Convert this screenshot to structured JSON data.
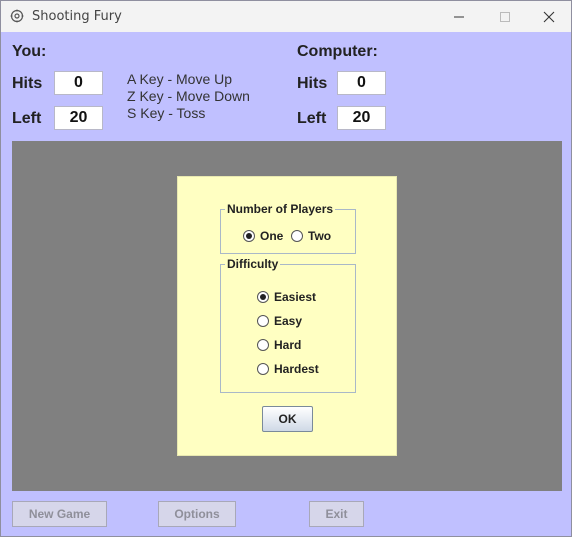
{
  "window": {
    "title": "Shooting Fury",
    "icon": "gear-icon",
    "controls": [
      "minimize-icon",
      "maximize-icon",
      "close-icon"
    ]
  },
  "player": {
    "heading": "You:",
    "hits_label": "Hits",
    "hits_value": "0",
    "left_label": "Left",
    "left_value": "20"
  },
  "keys": {
    "line1": "A Key - Move Up",
    "line2": "Z Key - Move Down",
    "line3": "S Key - Toss"
  },
  "computer": {
    "heading": "Computer:",
    "hits_label": "Hits",
    "hits_value": "0",
    "left_label": "Left",
    "left_value": "20"
  },
  "dialog": {
    "players_group": "Number of Players",
    "players_options": [
      "One",
      "Two"
    ],
    "players_selected": "One",
    "difficulty_group": "Difficulty",
    "difficulty_options": [
      "Easiest",
      "Easy",
      "Hard",
      "Hardest"
    ],
    "difficulty_selected": "Easiest",
    "ok_label": "OK"
  },
  "buttons": {
    "new_game": "New Game",
    "options": "Options",
    "exit": "Exit"
  },
  "colors": {
    "window_bg": "#c0c0ff",
    "board_bg": "#808080",
    "dialog_bg": "#ffffc2"
  }
}
